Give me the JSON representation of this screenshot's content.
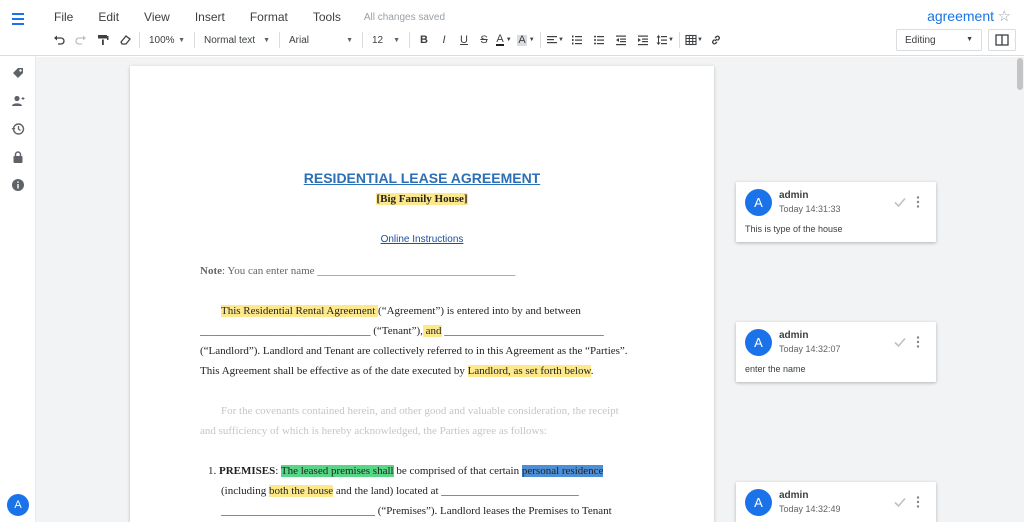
{
  "header": {
    "menus": [
      "File",
      "Edit",
      "View",
      "Insert",
      "Format",
      "Tools"
    ],
    "save_status": "All changes saved",
    "doc_title": "agreement",
    "star_icon": "star-outline-icon"
  },
  "toolbar": {
    "zoom": "100%",
    "style": "Normal text",
    "font": "Arial",
    "font_size": "12",
    "bold": "B",
    "italic": "I",
    "underline": "U",
    "strike": "S",
    "text_color": "A",
    "highlight_color": "A",
    "mode": "Editing"
  },
  "user": {
    "initial": "A"
  },
  "document": {
    "title": "RESIDENTIAL LEASE AGREEMENT",
    "subtitle": "[Big Family House]",
    "link": "Online Instructions",
    "note_label": "Note",
    "note_text": ": You can enter name ____________________________________",
    "p1_hl": "This Residential Rental Agreement ",
    "p1_a": "(“Agreement”) is entered into by and between",
    "p2_a": "_______________________________ (“Tenant”),",
    "p2_hl": " and",
    "p2_b": " _____________________________",
    "p3": "(“Landlord”). Landlord and Tenant are collectively referred to in this Agreement as the “Parties”.",
    "p4_a": "This Agreement shall be effective as of the date executed by ",
    "p4_hl": "Landlord, as set forth below",
    "p4_b": ".",
    "p5": "For the covenants contained herein, and other good and valuable consideration, the receipt",
    "p6": "and sufficiency of which is hereby acknowledged, the Parties agree as follows:",
    "item1_num": "1.",
    "item1_label": "PREMISES",
    "item1_colon": ":  ",
    "item1_green": "The leased premises shall",
    "item1_mid": " be comprised of that certain ",
    "item1_blue": "personal residence",
    "item1_l2_a": "(including ",
    "item1_l2_hl": "both the house",
    "item1_l2_b": " and the land) located at _________________________",
    "item1_l3": "____________________________ (“Premises”). Landlord leases the Premises to Tenant"
  },
  "comments": [
    {
      "author": "admin",
      "time": "Today 14:31:33",
      "text": "This is type of the house",
      "avatar": "A"
    },
    {
      "author": "admin",
      "time": "Today 14:32:07",
      "text": "enter the name",
      "avatar": "A"
    },
    {
      "author": "admin",
      "time": "Today 14:32:49",
      "text": "",
      "avatar": "A"
    }
  ],
  "colors": {
    "accent": "#1a73e8",
    "heading_blue": "#2b6fb6",
    "highlight_yellow": "#fde98b",
    "highlight_green": "#57d685",
    "highlight_blue": "#4d8fd6"
  }
}
